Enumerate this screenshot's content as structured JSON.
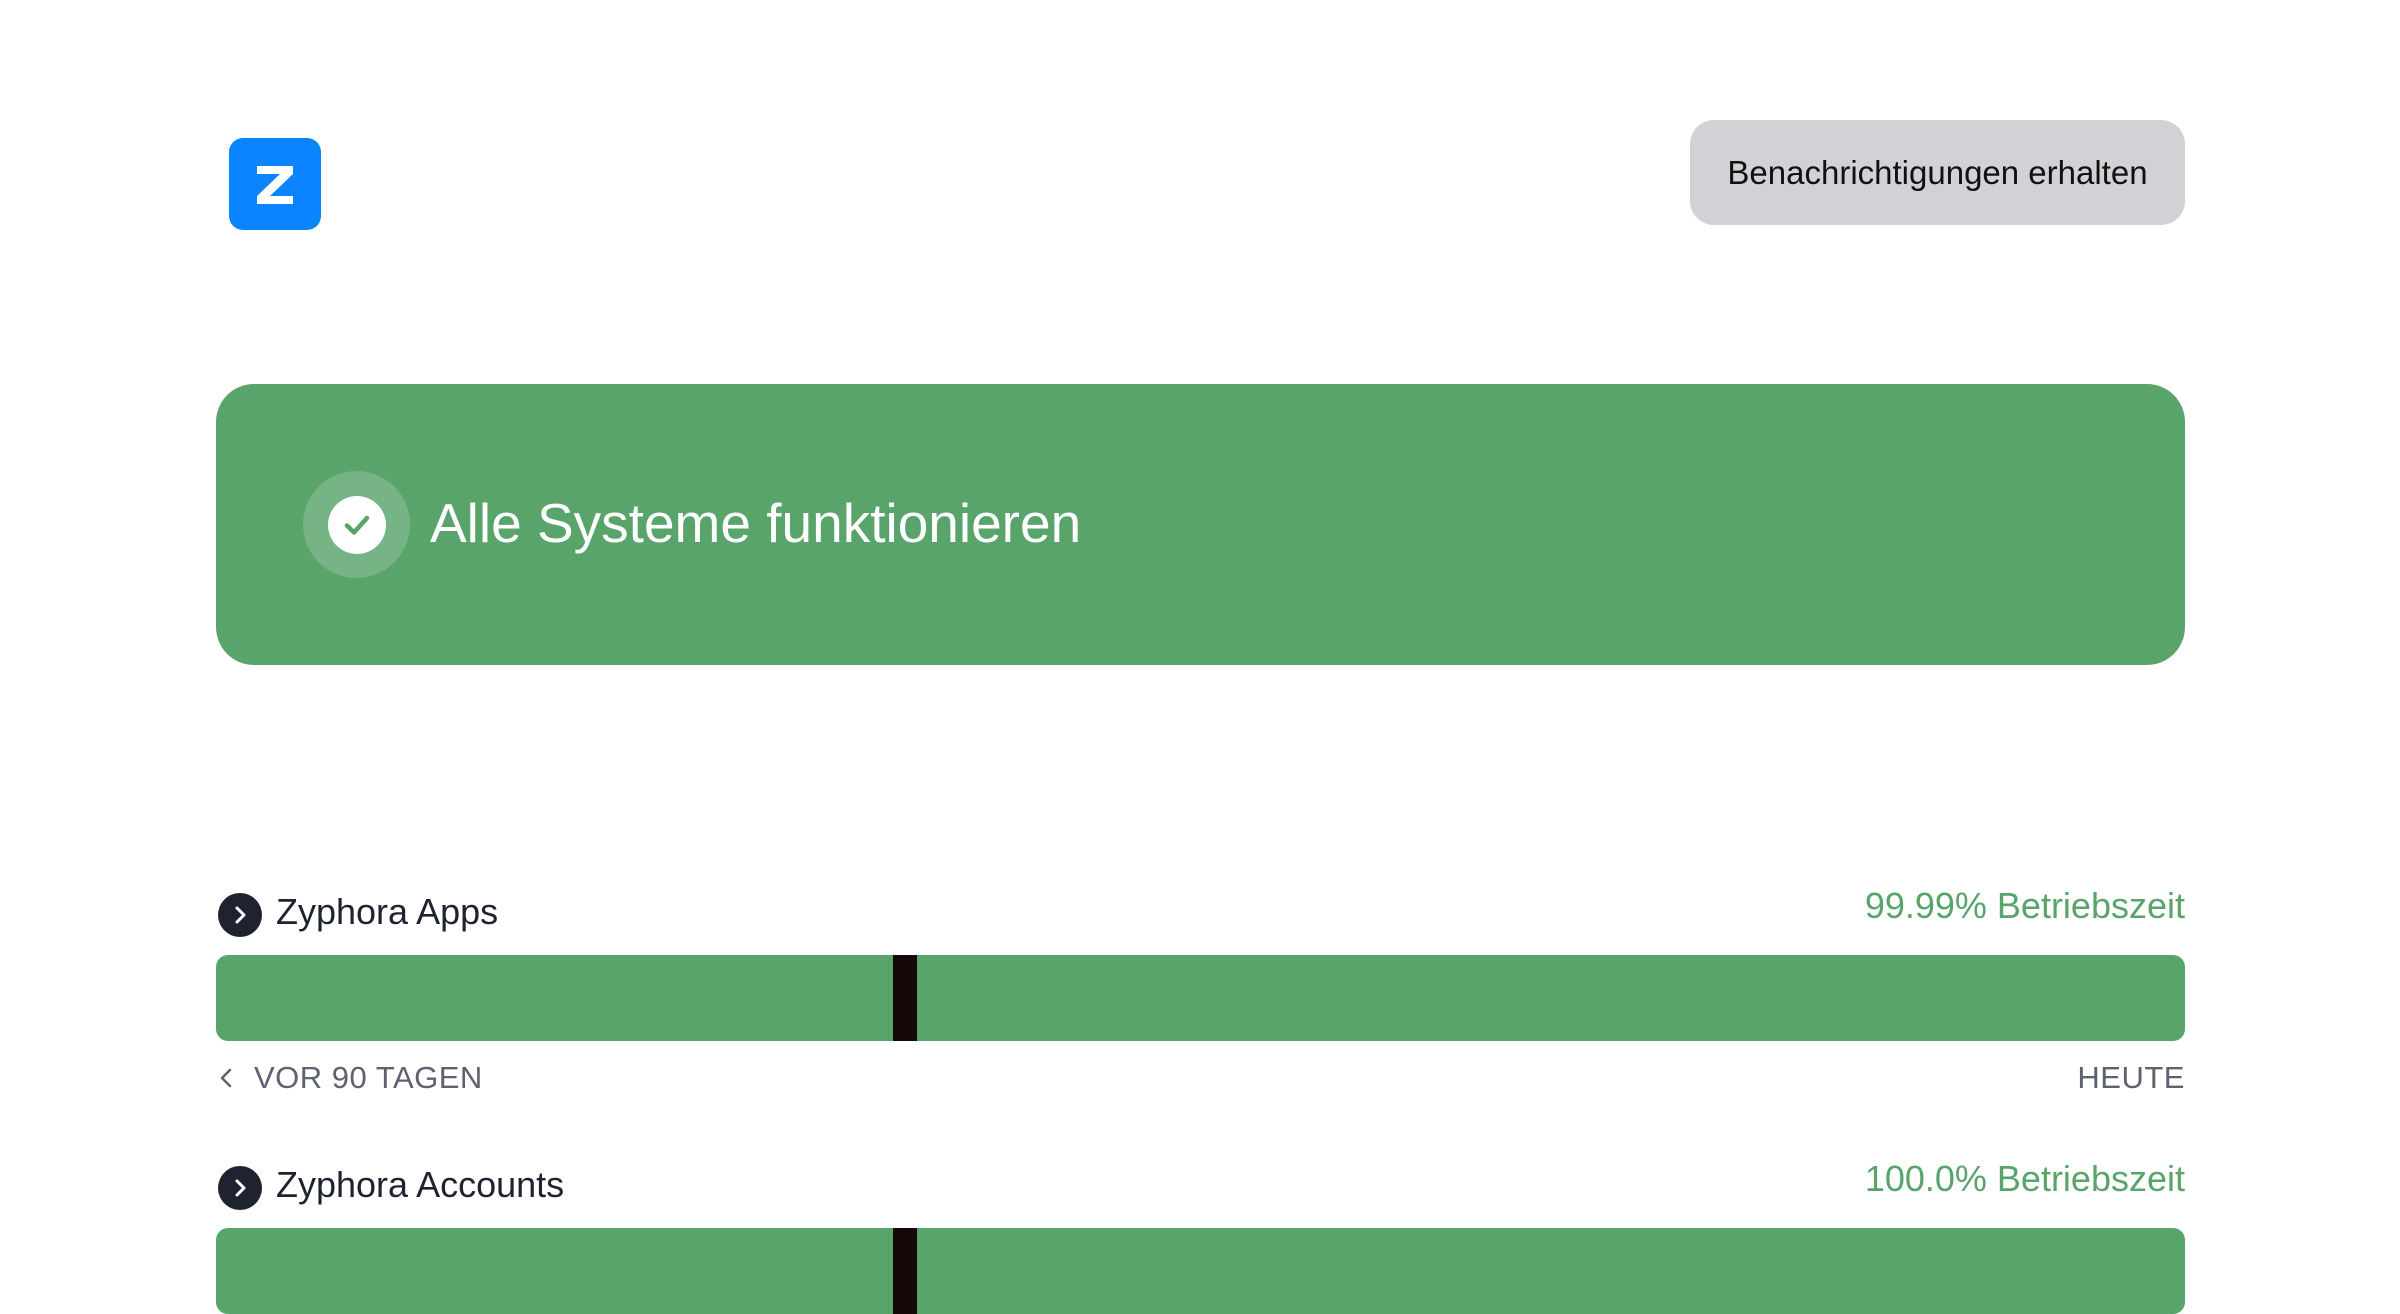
{
  "header": {
    "logo_icon": "zyphora-z-logo-icon",
    "logo_color": "#0a84ff",
    "subscribe_label": "Benachrichtigungen erhalten"
  },
  "status": {
    "title": "Alle Systeme funktionieren",
    "icon": "check-circle-icon",
    "color": "#58a46b"
  },
  "components": [
    {
      "name": "Zyphora Apps",
      "uptime": "99.99% Betriebszeit",
      "range_start": "VOR 90 TAGEN",
      "range_end": "HEUTE",
      "incident_day": 31,
      "days": 90
    },
    {
      "name": "Zyphora Accounts",
      "uptime": "100.0% Betriebszeit",
      "incident_day": 31,
      "days": 90
    }
  ],
  "colors": {
    "operational": "#58a46b",
    "incident": "#140808",
    "text": "#1f2330",
    "muted": "#5e6270"
  }
}
